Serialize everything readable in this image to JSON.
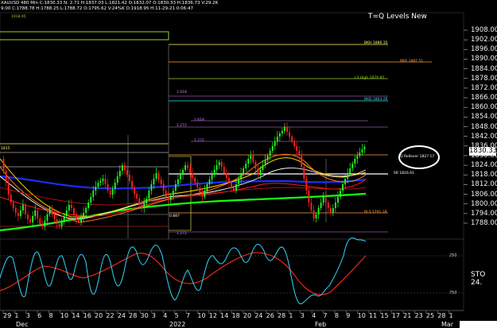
{
  "header": {
    "line1": "XAUUSD 480 Min  C:1830.33  N:  2.71  H:1837.03  L:1821.42  O:1832.07  O:1830.33  H:1836.73  V:29.2K",
    "line2": "9:00  C:1788.78  H:1788.25  L:1788.72  O:1795.62  V:24%K  O:1918.95  H:11-29-21  0:06:47"
  },
  "title": "T=Q Levels New",
  "levels": [
    {
      "label": "1918.95",
      "color": "#9ad22a"
    },
    {
      "label": "BKH 1886 35",
      "color": "#ffff66"
    },
    {
      "label": "BKR 1887 51",
      "color": "#ff9a3c"
    },
    {
      "label": "LS High 1879 85",
      "color": "#9ad22a"
    },
    {
      "label": "BKD 1863 26",
      "color": "#33e0e0"
    },
    {
      "label": "1.618",
      "color": "#d080ff"
    },
    {
      "label": "1.272",
      "color": "#d080ff"
    },
    {
      "label": "1.618",
      "color": "#d080ff"
    },
    {
      "label": "1.272",
      "color": "#d080ff"
    },
    {
      "label": "Q Rollover 1827 17",
      "color": "#ffffff"
    },
    {
      "label": "SR 1816.61",
      "color": "#ffffff"
    },
    {
      "label": "BLS 1791 38",
      "color": "#ff9a3c"
    },
    {
      "label": "1.272",
      "color": "#d080ff"
    },
    {
      "label": "1815",
      "color": "#ffff66"
    },
    {
      "label": "0.887",
      "color": "#ffffff"
    }
  ],
  "price_axis": {
    "labels": [
      "1908.00",
      "1902.00",
      "1896.00",
      "1890.00",
      "1884.00",
      "1878.00",
      "1872.00",
      "1866.00",
      "1860.00",
      "1854.00",
      "1848.00",
      "1842.00",
      "1836.00",
      "1830.00",
      "1824.00",
      "1818.00",
      "1812.00",
      "1806.00",
      "1800.00",
      "1794.00",
      "1788.00"
    ],
    "current_price": "1830.33"
  },
  "stochastic": {
    "label": "STO 24.",
    "ticks": [
      "250",
      "750"
    ]
  },
  "time_axis": {
    "days": [
      "29",
      "1",
      "3",
      "6",
      "8",
      "10",
      "14",
      "16",
      "20",
      "22",
      "24",
      "28",
      "30",
      "3",
      "4",
      "5",
      "7",
      "10",
      "12",
      "14",
      "18",
      "20",
      "24",
      "26",
      "28",
      "1",
      "3",
      "4",
      "7",
      "8",
      "9",
      "10",
      "11",
      "15",
      "17",
      "21",
      "23",
      "25",
      "28",
      "1"
    ],
    "months": [
      "Dec",
      "2022",
      "Feb",
      "Mar"
    ]
  },
  "colors": {
    "background": "#000000",
    "bull_candle": "#22ff22",
    "bear_candle": "#ff2222",
    "rsi_line": "#33d6ff",
    "signal_line": "#ff2a1a",
    "ma_blue": "#1a2eff",
    "ma_green": "#14ff14",
    "ma_white": "#ffffff",
    "ma_yellow": "#ffd000",
    "ma_orange": "#ff7a20",
    "ma_red": "#ff1a1a"
  }
}
